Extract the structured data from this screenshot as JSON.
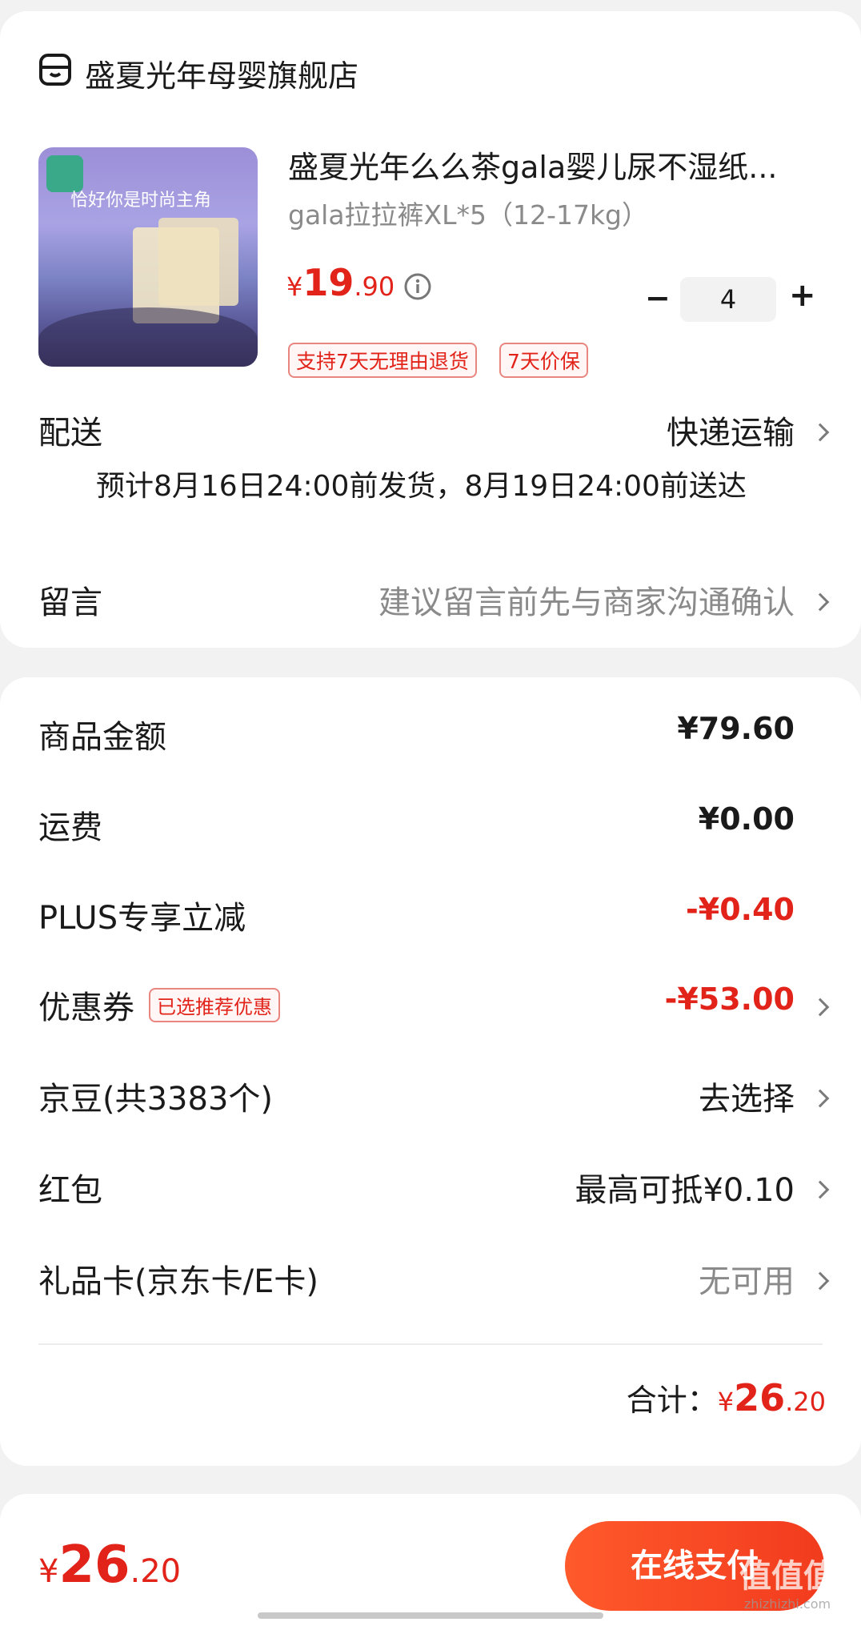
{
  "shop": {
    "icon": "shop-icon",
    "name": "盛夏光年母婴旗舰店"
  },
  "product": {
    "image_text": "恰好你是时尚主角",
    "title": "盛夏光年么么茶gala婴儿尿不湿纸...",
    "spec": "gala拉拉裤XL*5（12-17kg）",
    "price_symbol": "¥",
    "price_int": "19",
    "price_dec": ".90",
    "info_icon": "info-icon",
    "quantity": "4",
    "minus": "−",
    "plus": "+",
    "tags": [
      "支持7天无理由退货",
      "7天价保"
    ]
  },
  "delivery": {
    "label": "配送",
    "value": "快递运输",
    "estimate": "预计8月16日24:00前发货，8月19日24:00前送达"
  },
  "message": {
    "label": "留言",
    "placeholder": "建议留言前先与商家沟通确认"
  },
  "summary": {
    "goods_label": "商品金额",
    "goods_value": "¥79.60",
    "shipping_label": "运费",
    "shipping_value": "¥0.00",
    "plus_label": "PLUS专享立减",
    "plus_value": "-¥0.40",
    "coupon_label": "优惠券",
    "coupon_tag": "已选推荐优惠",
    "coupon_value": "-¥53.00",
    "jd_bean_label": "京豆(共3383个)",
    "jd_bean_value": "去选择",
    "red_packet_label": "红包",
    "red_packet_value": "最高可抵¥0.10",
    "gift_card_label": "礼品卡(京东卡/E卡)",
    "gift_card_value": "无可用",
    "total_label": "合计：",
    "total_symbol": "¥",
    "total_int": "26",
    "total_dec": ".20"
  },
  "bottom_bar": {
    "price_symbol": "¥",
    "price_int": "26",
    "price_dec": ".20",
    "pay_button": "在线支付",
    "watermark": "值值值",
    "watermark_url": "zhizhizhi.com"
  },
  "colors": {
    "accent": "#e2231a",
    "pay_button": "#f03a1e"
  }
}
